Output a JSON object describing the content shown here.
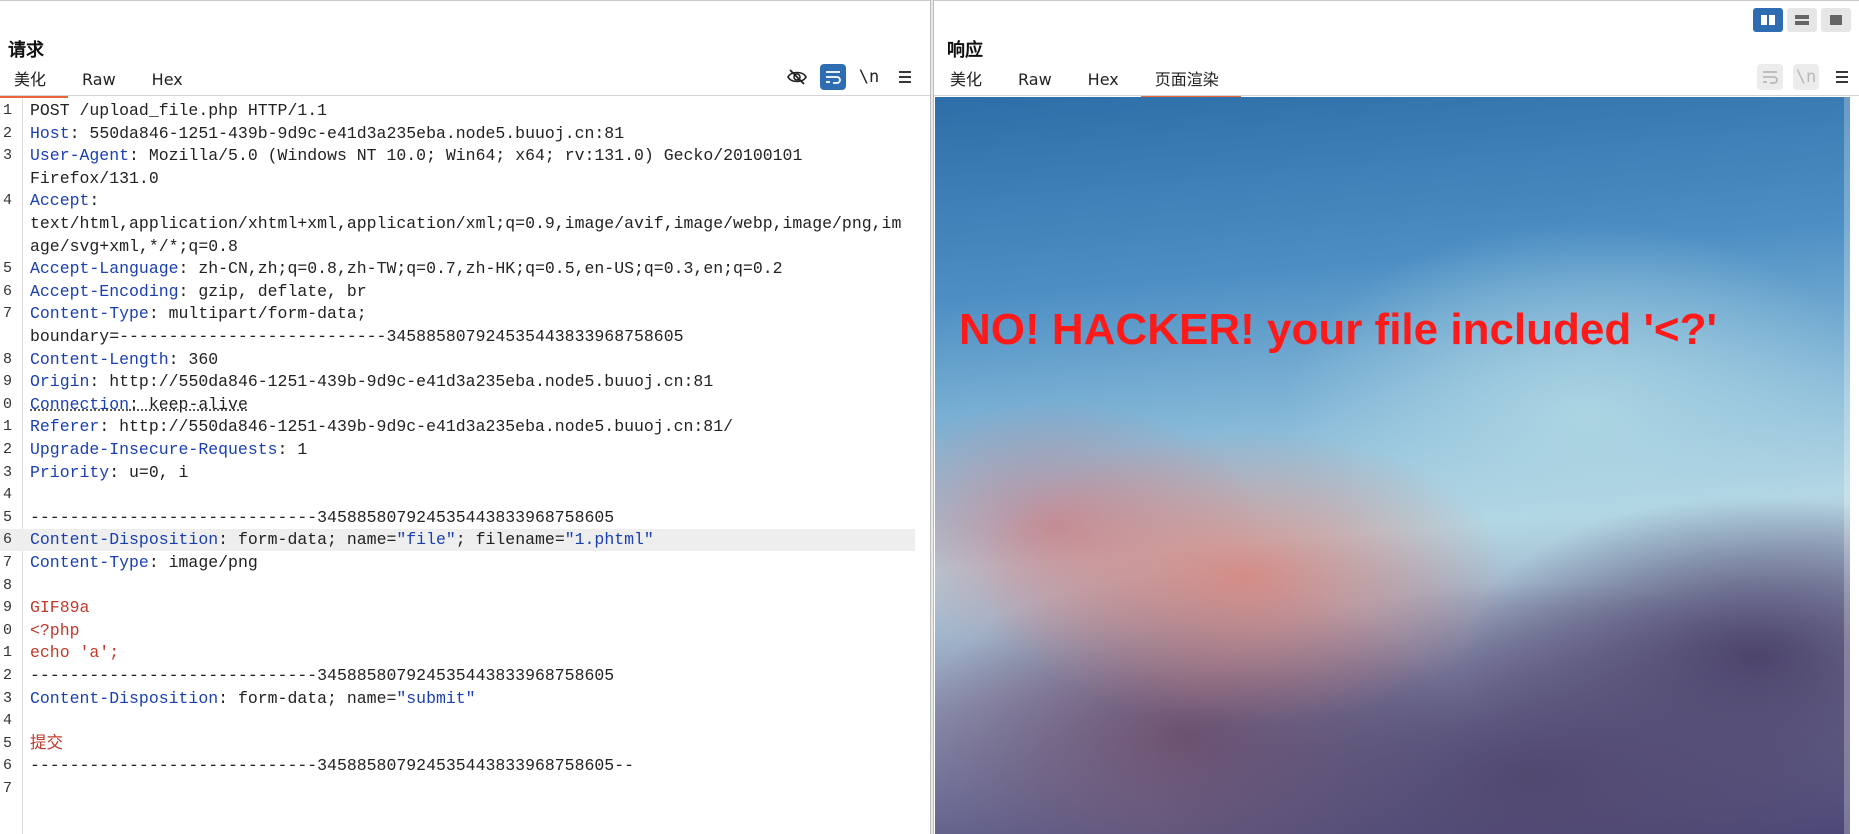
{
  "request": {
    "title": "请求",
    "tabs": [
      "美化",
      "Raw",
      "Hex"
    ],
    "active_tab": "美化",
    "toolbar": {
      "hide_icon": "eye-off-icon",
      "wrap_icon": "wrap-icon",
      "newline_label": "\\n",
      "menu_icon": "menu-icon"
    },
    "lines": [
      {
        "n": "1",
        "plain": "POST /upload_file.php HTTP/1.1"
      },
      {
        "n": "2",
        "key": "Host",
        "val": ": 550da846-1251-439b-9d9c-e41d3a235eba.node5.buuoj.cn:81"
      },
      {
        "n": "3",
        "key": "User-Agent",
        "val": ": Mozilla/5.0 (Windows NT 10.0; Win64; x64; rv:131.0) Gecko/20100101"
      },
      {
        "n": "",
        "plain": "Firefox/131.0"
      },
      {
        "n": "4",
        "key": "Accept",
        "val": ":"
      },
      {
        "n": "",
        "plain": "text/html,application/xhtml+xml,application/xml;q=0.9,image/avif,image/webp,image/png,im"
      },
      {
        "n": "",
        "plain": "age/svg+xml,*/*;q=0.8"
      },
      {
        "n": "5",
        "key": "Accept-Language",
        "val": ": zh-CN,zh;q=0.8,zh-TW;q=0.7,zh-HK;q=0.5,en-US;q=0.3,en;q=0.2"
      },
      {
        "n": "6",
        "key": "Accept-Encoding",
        "val": ": gzip, deflate, br"
      },
      {
        "n": "7",
        "key": "Content-Type",
        "val": ": multipart/form-data;"
      },
      {
        "n": "",
        "plain": "boundary=---------------------------345885807924535443833968758605"
      },
      {
        "n": "8",
        "key": "Content-Length",
        "val": ": 360"
      },
      {
        "n": "9",
        "key": "Origin",
        "val": ": http://550da846-1251-439b-9d9c-e41d3a235eba.node5.buuoj.cn:81"
      },
      {
        "n": "0",
        "key": "Connection",
        "val": ": keep-alive",
        "underline": true
      },
      {
        "n": "1",
        "key": "Referer",
        "val": ": http://550da846-1251-439b-9d9c-e41d3a235eba.node5.buuoj.cn:81/"
      },
      {
        "n": "2",
        "key": "Upgrade-Insecure-Requests",
        "val": ": 1"
      },
      {
        "n": "3",
        "key": "Priority",
        "val": ": u=0, i"
      },
      {
        "n": "4",
        "plain": ""
      },
      {
        "n": "5",
        "plain": "-----------------------------345885807924535443833968758605"
      },
      {
        "n": "6",
        "key": "Content-Disposition",
        "val": ": form-data; name=",
        "s1": "\"file\"",
        "mid": "; filename=",
        "s2": "\"1.phtml\"",
        "highlight": true
      },
      {
        "n": "7",
        "key": "Content-Type",
        "val": ": image/png"
      },
      {
        "n": "8",
        "plain": ""
      },
      {
        "n": "9",
        "red": "GIF89a"
      },
      {
        "n": "0",
        "red": "<?php"
      },
      {
        "n": "1",
        "red": "echo 'a';"
      },
      {
        "n": "2",
        "plain": "-----------------------------345885807924535443833968758605"
      },
      {
        "n": "3",
        "key": "Content-Disposition",
        "val": ": form-data; name=",
        "s1": "\"submit\""
      },
      {
        "n": "4",
        "plain": ""
      },
      {
        "n": "5",
        "red": "提交"
      },
      {
        "n": "6",
        "plain": "-----------------------------345885807924535443833968758605--"
      },
      {
        "n": "7",
        "plain": ""
      }
    ]
  },
  "response": {
    "title": "响应",
    "tabs": [
      "美化",
      "Raw",
      "Hex",
      "页面渲染"
    ],
    "active_tab": "页面渲染",
    "toolbar": {
      "wrap_icon": "wrap-icon",
      "newline_label": "\\n",
      "menu_icon": "menu-icon"
    },
    "rendered_message": "NO! HACKER! your file included '<?'"
  },
  "layout_toggles": [
    "split-vertical-icon",
    "split-horizontal-icon",
    "single-pane-icon"
  ],
  "colors": {
    "accent_tab": "#e8663a",
    "toggle_active": "#2f6db3",
    "header_key": "#1a3fb1",
    "body_red": "#c0392b",
    "render_text": "#ff1a1a"
  }
}
